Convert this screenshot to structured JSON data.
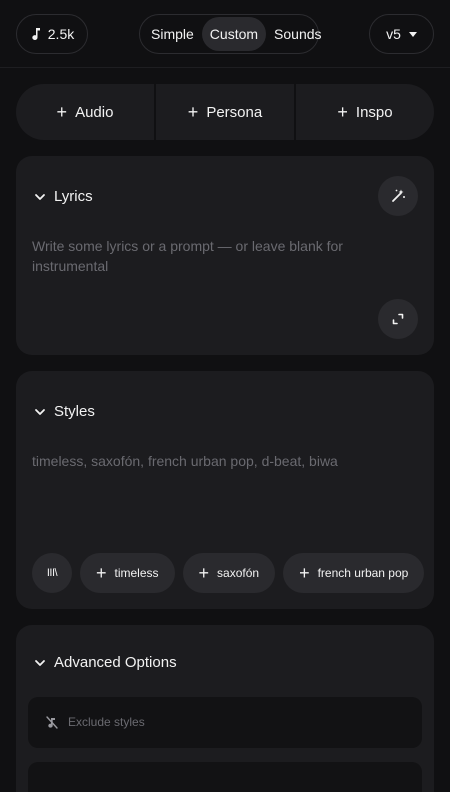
{
  "header": {
    "credits": "2.5k",
    "modes": [
      {
        "label": "Simple",
        "active": false
      },
      {
        "label": "Custom",
        "active": true
      },
      {
        "label": "Sounds",
        "active": false
      }
    ],
    "version": "v5"
  },
  "add_buttons": [
    {
      "label": "Audio"
    },
    {
      "label": "Persona"
    },
    {
      "label": "Inspo"
    }
  ],
  "lyrics": {
    "title": "Lyrics",
    "placeholder": "Write some lyrics or a prompt — or leave blank for instrumental"
  },
  "styles": {
    "title": "Styles",
    "placeholder": "timeless, saxofón, french urban pop, d-beat, biwa",
    "library_icon_text": "III\\",
    "chips": [
      "timeless",
      "saxofón",
      "french urban pop"
    ]
  },
  "advanced": {
    "title": "Advanced Options",
    "exclude_placeholder": "Exclude styles"
  },
  "icons": {
    "credits": "music-note-icon",
    "magic": "magic-wand-icon",
    "expand": "expand-icon",
    "exclude": "music-off-icon"
  }
}
